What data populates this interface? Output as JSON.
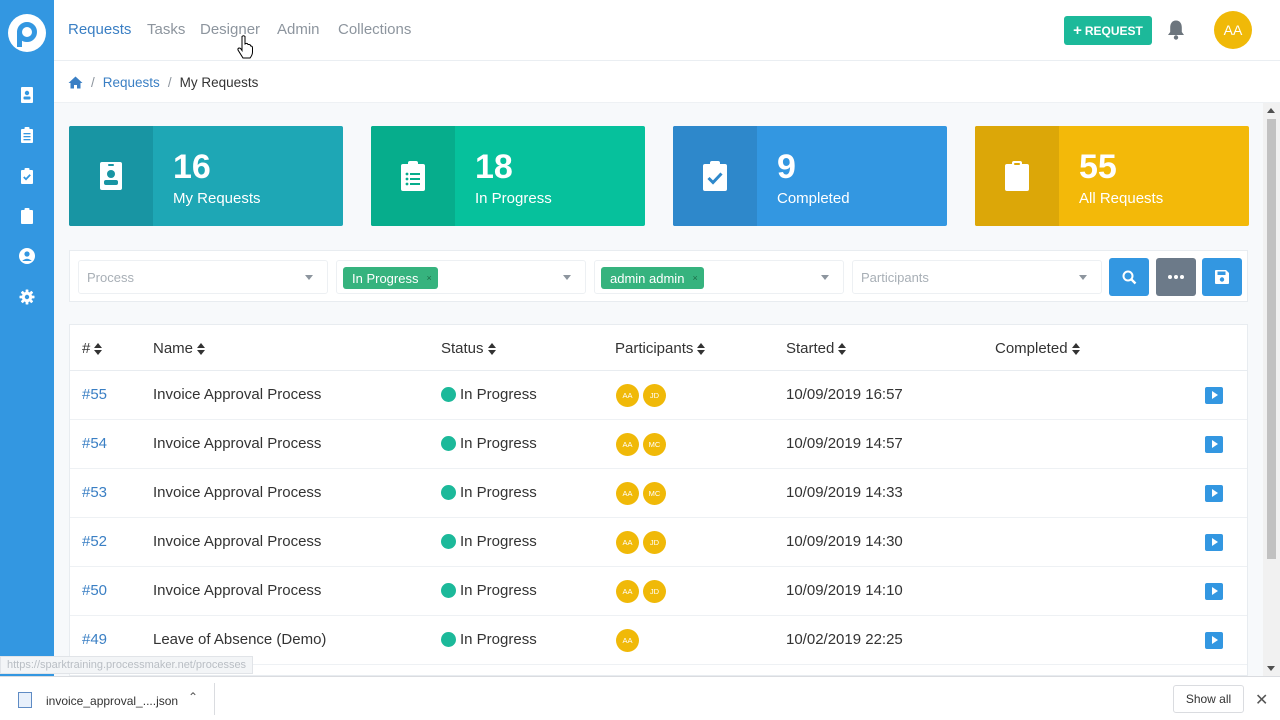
{
  "nav": {
    "items": [
      {
        "label": "Requests",
        "active": true
      },
      {
        "label": "Tasks",
        "active": false
      },
      {
        "label": "Designer",
        "active": false
      },
      {
        "label": "Admin",
        "active": false
      },
      {
        "label": "Collections",
        "active": false
      }
    ],
    "request_button": "REQUEST",
    "avatar_initials": "AA"
  },
  "sidebar": {
    "icons": [
      "id-card-icon",
      "clipboard-list-icon",
      "clipboard-check-icon",
      "clipboard-icon",
      "user-circle-icon",
      "gear-icon"
    ]
  },
  "breadcrumb": {
    "separator": "/",
    "items": [
      "Requests",
      "My Requests"
    ]
  },
  "cards": [
    {
      "count": "16",
      "label": "My Requests",
      "color": "#1ea7b5",
      "icon_bg": "#1895a3",
      "icon": "id-card-icon"
    },
    {
      "count": "18",
      "label": "In Progress",
      "color": "#06c19c",
      "icon_bg": "#06ad8c",
      "icon": "clipboard-list-icon"
    },
    {
      "count": "9",
      "label": "Completed",
      "color": "#3397e1",
      "icon_bg": "#2e88cb",
      "icon": "clipboard-check-icon"
    },
    {
      "count": "55",
      "label": "All Requests",
      "color": "#f3b909",
      "icon_bg": "#dca708",
      "icon": "clipboard-icon"
    }
  ],
  "filters": {
    "process_placeholder": "Process",
    "status_tag": "In Progress",
    "requester_tag": "admin admin",
    "participants_placeholder": "Participants",
    "tag_remove": "×"
  },
  "table": {
    "headers": [
      "#",
      "Name",
      "Status",
      "Participants",
      "Started",
      "Completed"
    ],
    "rows": [
      {
        "id": "#55",
        "name": "Invoice Approval Process",
        "status": "In Progress",
        "participants": [
          "AA",
          "JD"
        ],
        "started": "10/09/2019 16:57",
        "completed": ""
      },
      {
        "id": "#54",
        "name": "Invoice Approval Process",
        "status": "In Progress",
        "participants": [
          "AA",
          "MC"
        ],
        "started": "10/09/2019 14:57",
        "completed": ""
      },
      {
        "id": "#53",
        "name": "Invoice Approval Process",
        "status": "In Progress",
        "participants": [
          "AA",
          "MC"
        ],
        "started": "10/09/2019 14:33",
        "completed": ""
      },
      {
        "id": "#52",
        "name": "Invoice Approval Process",
        "status": "In Progress",
        "participants": [
          "AA",
          "JD"
        ],
        "started": "10/09/2019 14:30",
        "completed": ""
      },
      {
        "id": "#50",
        "name": "Invoice Approval Process",
        "status": "In Progress",
        "participants": [
          "AA",
          "JD"
        ],
        "started": "10/09/2019 14:10",
        "completed": ""
      },
      {
        "id": "#49",
        "name": "Leave of Absence (Demo)",
        "status": "In Progress",
        "participants": [
          "AA"
        ],
        "started": "10/02/2019 22:25",
        "completed": ""
      }
    ]
  },
  "status_url": "https://sparktraining.processmaker.net/processes",
  "download_bar": {
    "file_name": "invoice_approval_....json",
    "show_all": "Show all"
  }
}
